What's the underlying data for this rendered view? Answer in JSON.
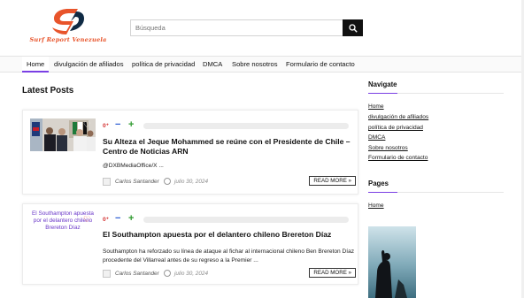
{
  "brand": {
    "name": "Surf Report Venezuela",
    "colors": {
      "orange": "#e8542b",
      "navy": "#0f2a44",
      "accent": "#7a3fe4"
    }
  },
  "search": {
    "placeholder": "Búsqueda",
    "icon": "search-icon"
  },
  "nav": {
    "items": [
      {
        "label": "Home",
        "active": true
      },
      {
        "label": "divulgación de afiliados",
        "active": false
      },
      {
        "label": "política de privacidad",
        "active": false
      },
      {
        "label": "DMCA",
        "active": false
      },
      {
        "label": "Sobre nosotros",
        "active": false
      },
      {
        "label": "Formulario de contacto",
        "active": false
      }
    ]
  },
  "main": {
    "section_title": "Latest Posts",
    "posts": [
      {
        "votes": "0⁺",
        "title": "Su Alteza el Jeque Mohammed se reúne con el Presidente de Chile – Centro de Noticias ARN",
        "excerpt": "@DXBMediaOffice/X ...",
        "author": "Carlos Santander",
        "date": "julio 30, 2024",
        "read_more": "READ MORE »",
        "image_alt": ""
      },
      {
        "votes": "0⁺",
        "title": "El Southampton apuesta por el delantero chileno Brereton Díaz",
        "excerpt": "Southampton ha reforzado su línea de ataque al fichar al internacional chileno Ben Brereton Díaz procedente del Villarreal antes de su regreso a la Premier ...",
        "author": "Carlos Santander",
        "date": "julio 30, 2024",
        "read_more": "READ MORE »",
        "image_alt": "El Southampton apuesta por el delantero chileno Brereton Díaz"
      }
    ]
  },
  "sidebar": {
    "navigate_title": "Navigate",
    "navigate_links": [
      "Home",
      "divulgación de afiliados",
      "política de privacidad",
      "DMCA",
      "Sobre nosotros",
      "Formulario de contacto"
    ],
    "pages_title": "Pages",
    "pages_links": [
      "Home"
    ]
  }
}
